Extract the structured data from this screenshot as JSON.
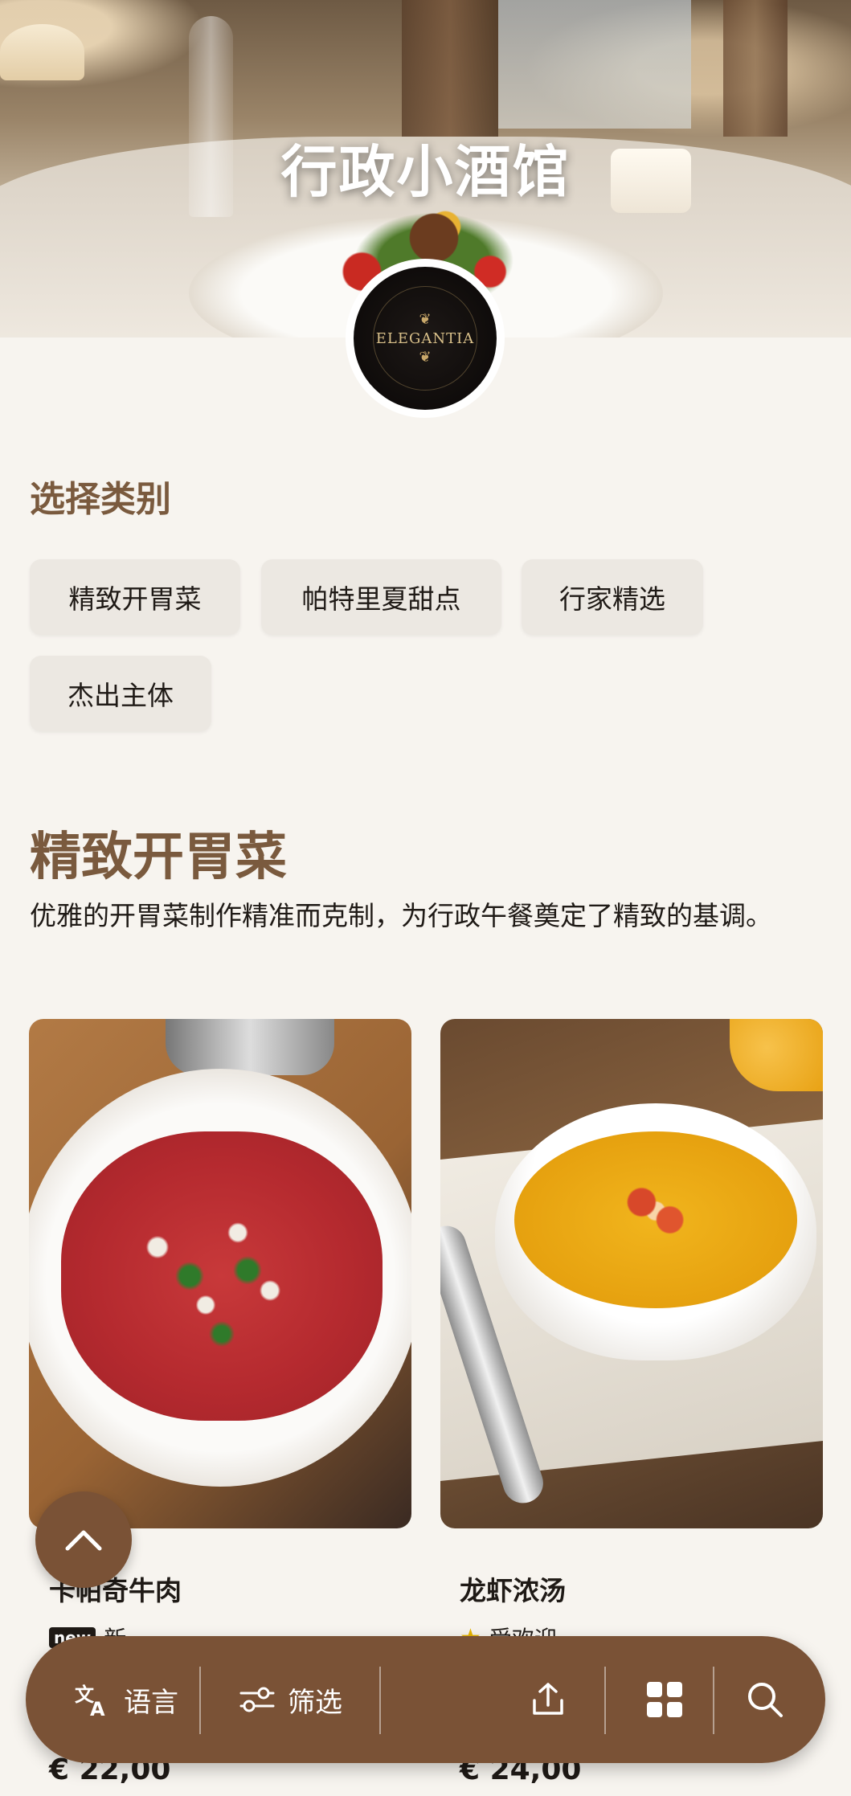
{
  "hero": {
    "title": "行政小酒馆",
    "logo_text": "ELEGANTIA"
  },
  "categories": {
    "heading": "选择类别",
    "items": [
      "精致开胃菜",
      "帕特里夏甜点",
      "行家精选",
      "杰出主体"
    ]
  },
  "section": {
    "title": "精致开胃菜",
    "description": "优雅的开胃菜制作精准而克制，为行政午餐奠定了精致的基调。"
  },
  "dishes": [
    {
      "name": "卡帕奇牛肉",
      "badge": "new",
      "tag": "新",
      "price": "€ 22,00",
      "image": "beef-carpaccio"
    },
    {
      "name": "龙虾浓汤",
      "badge": "star",
      "tag": "受欢迎",
      "price": "€ 24,00",
      "image": "lobster-bisque"
    }
  ],
  "bottom_nav": {
    "language_label": "语言",
    "filter_label": "筛选",
    "icons": [
      "translate-icon",
      "filter-icon",
      "share-icon",
      "grid-icon",
      "search-icon"
    ]
  },
  "colors": {
    "accent": "#7a5a3e",
    "nav_background": "#7a5236",
    "page_background": "#f7f4ef",
    "chip_background": "#ece8e2"
  }
}
